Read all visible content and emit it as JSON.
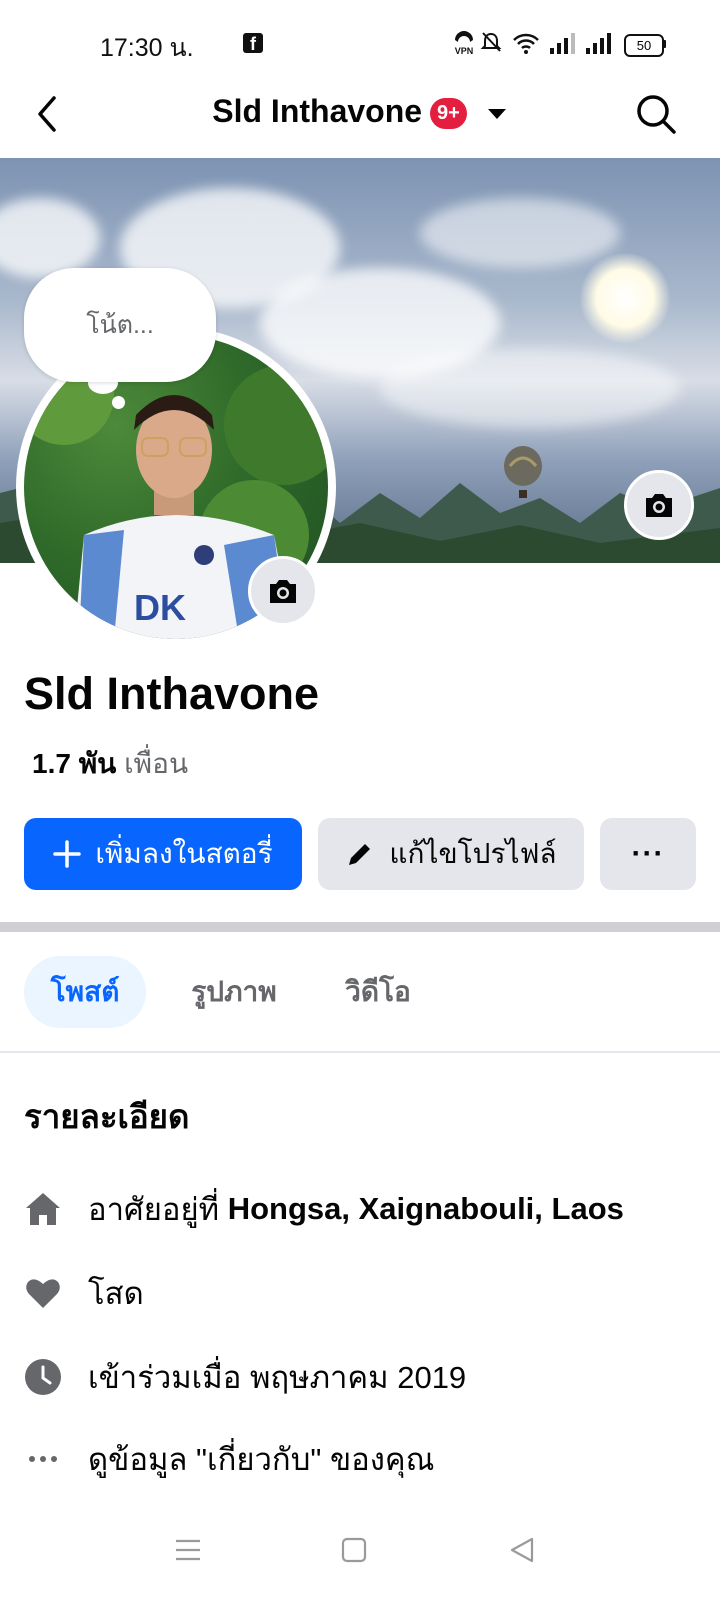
{
  "status_bar": {
    "time": "17:30 น.",
    "battery": "50"
  },
  "header": {
    "title": "Sld Inthavone",
    "badge": "9+"
  },
  "note": {
    "placeholder": "โน้ต..."
  },
  "profile": {
    "name": "Sld Inthavone",
    "friends_count": "1.7 พัน",
    "friends_label": "เพื่อน"
  },
  "actions": {
    "add_story": "เพิ่มลงในสตอรี่",
    "edit_profile": "แก้ไขโปรไฟล์",
    "more": "···"
  },
  "tabs": [
    {
      "label": "โพสต์",
      "active": true
    },
    {
      "label": "รูปภาพ",
      "active": false
    },
    {
      "label": "วิดีโอ",
      "active": false
    }
  ],
  "details": {
    "title": "รายละเอียด",
    "lives_prefix": "อาศัยอยู่ที่",
    "lives_place": "Hongsa, Xaignabouli, Laos",
    "relationship": "โสด",
    "joined": "เข้าร่วมเมื่อ พฤษภาคม 2019",
    "about_link": "ดูข้อมูล \"เกี่ยวกับ\" ของคุณ"
  },
  "colors": {
    "accent": "#0866ff",
    "badge": "#e41e3f",
    "secondary_button": "#e4e6eb"
  }
}
